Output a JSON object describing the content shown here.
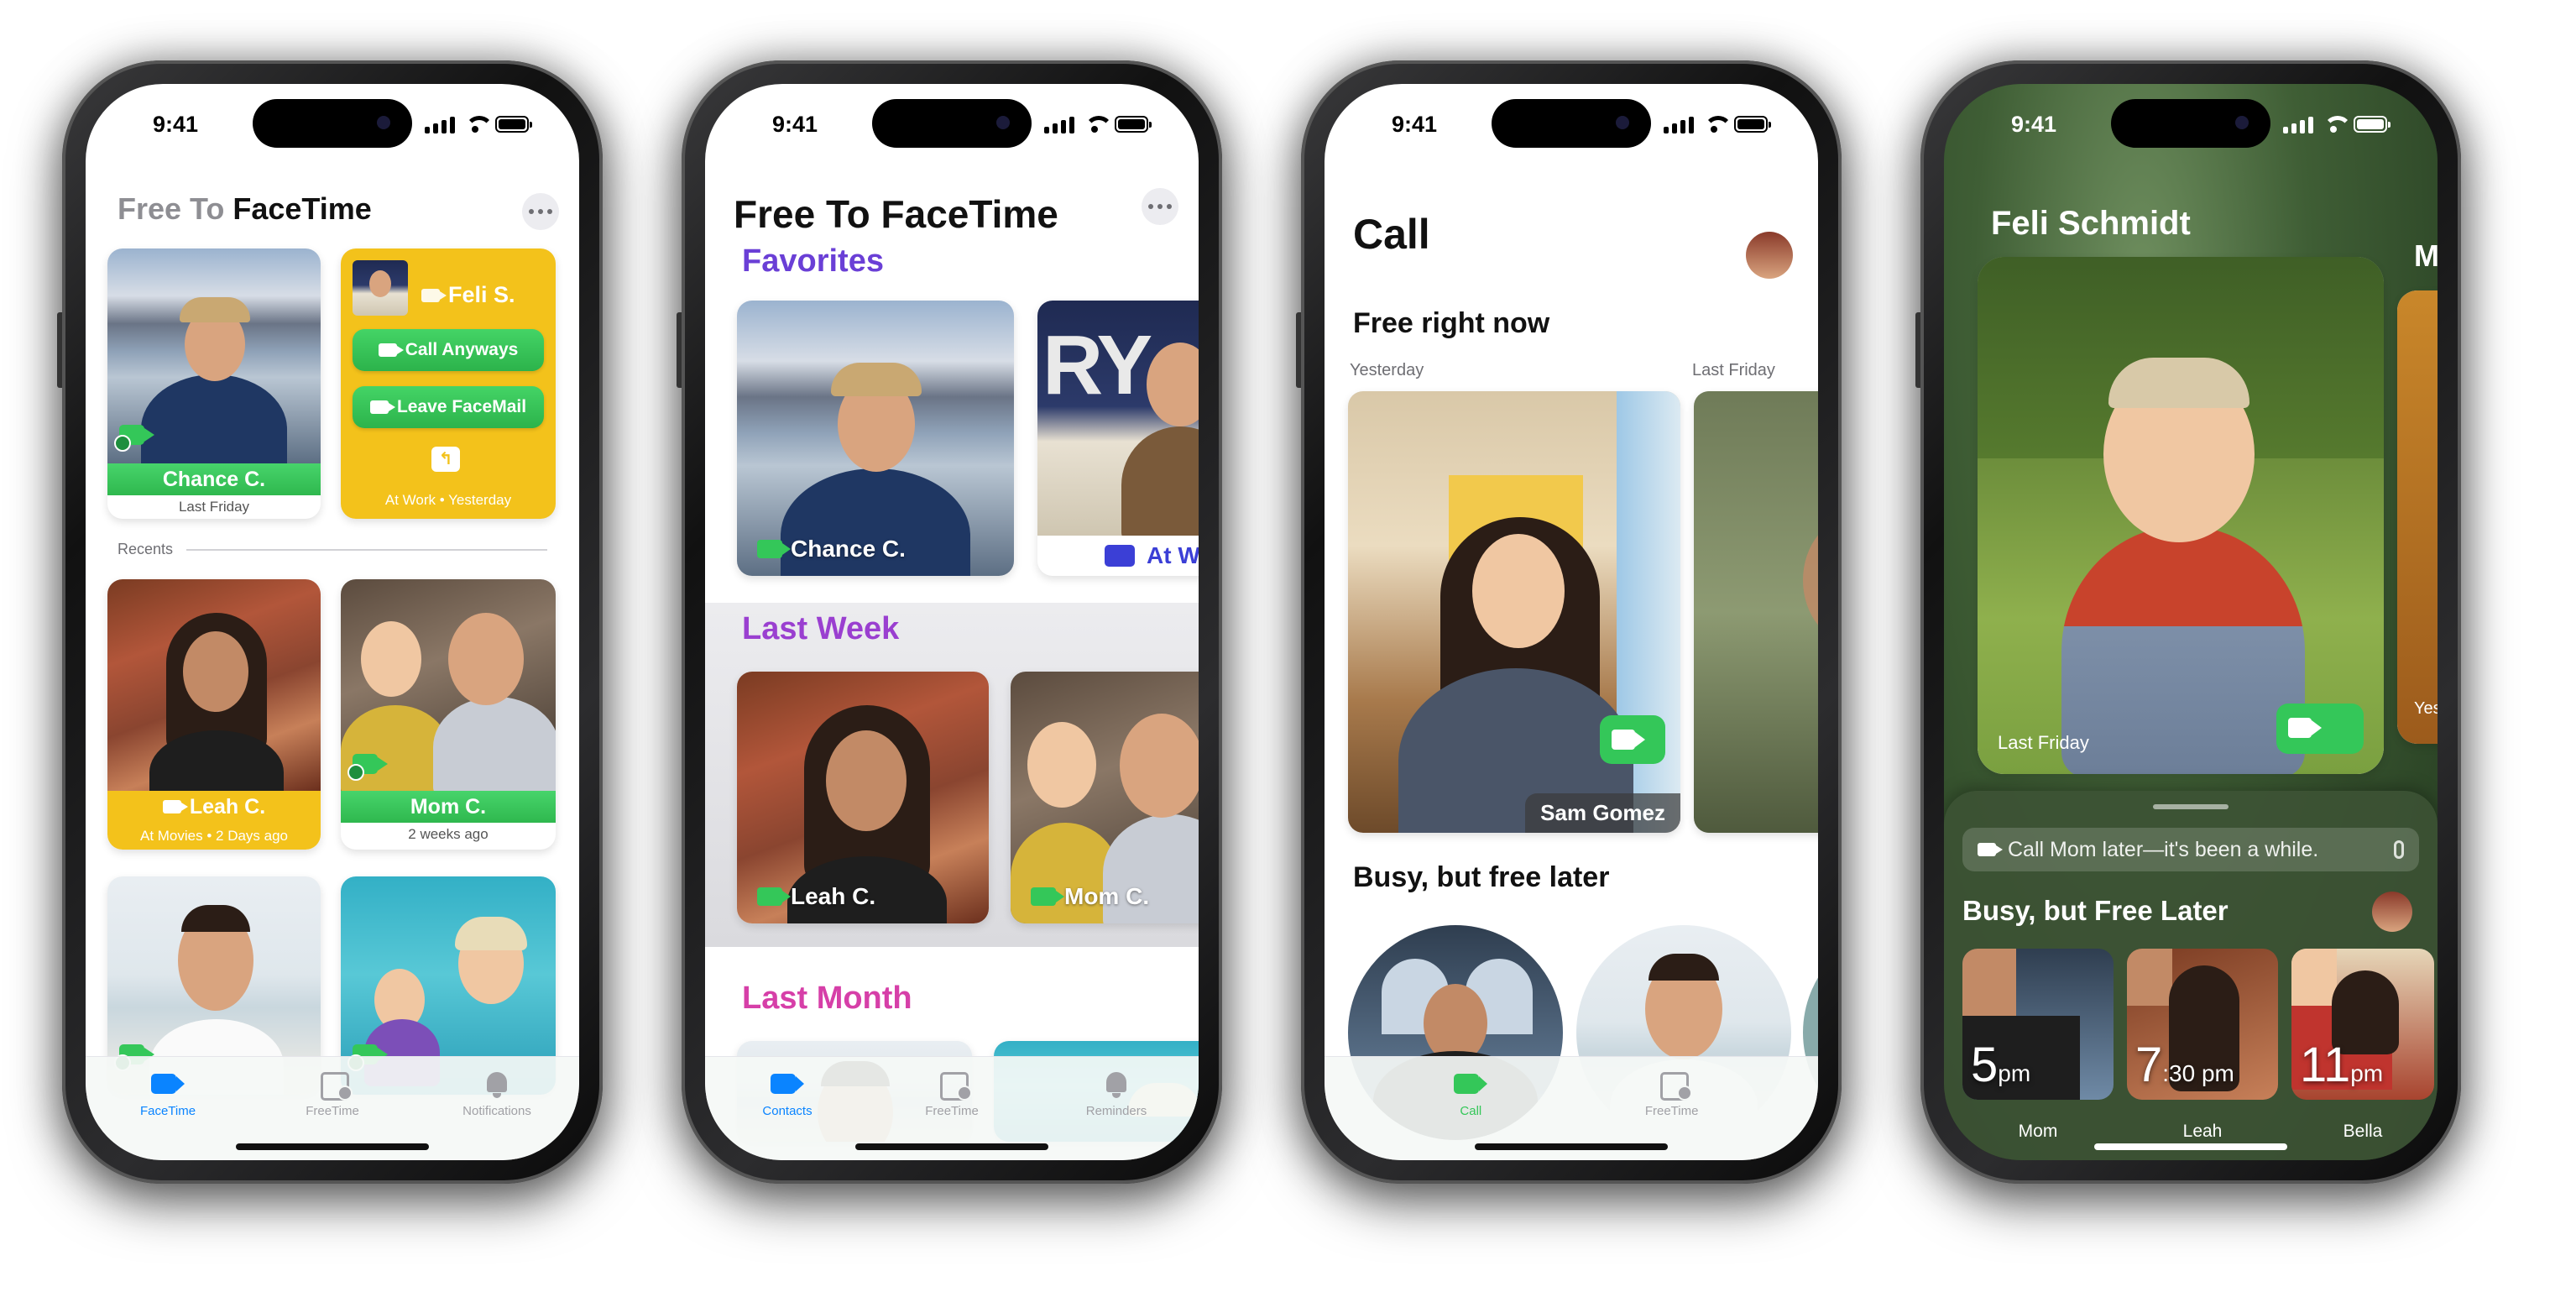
{
  "status_time": "9:41",
  "screen1": {
    "title_light": "Free To",
    "title_bold": "FaceTime",
    "fav1": {
      "name": "Chance C.",
      "caption": "Last Friday"
    },
    "fav2": {
      "name": "Feli S.",
      "call_anyways": "Call Anyways",
      "leave_facemail": "Leave FaceMail",
      "caption": "At Work • Yesterday"
    },
    "recents_label": "Recents",
    "recent1": {
      "name": "Leah C.",
      "caption": "At Movies • 2 Days ago"
    },
    "recent2": {
      "name": "Mom C.",
      "caption": "2 weeks ago"
    },
    "tabs": [
      "FaceTime",
      "FreeTime",
      "Notifications"
    ]
  },
  "screen2": {
    "title": "Free To FaceTime",
    "sections": {
      "favorites": "Favorites",
      "last_week": "Last Week",
      "last_month": "Last Month"
    },
    "fav1_name": "Chance C.",
    "fav2_status": "At W",
    "week1_name": "Leah C.",
    "week2_name": "Mom C.",
    "tabs": [
      "Contacts",
      "FreeTime",
      "Reminders"
    ]
  },
  "screen3": {
    "title": "Call",
    "free_now": "Free right now",
    "card1_when": "Yesterday",
    "card2_when": "Last Friday",
    "card1_name": "Sam Gomez",
    "busy_later": "Busy, but free later",
    "tabs": [
      "Call",
      "FreeTime"
    ]
  },
  "screen4": {
    "name": "Feli Schmidt",
    "next_peek": "Ma",
    "hero_caption": "Last Friday",
    "peek_caption": "Yeste",
    "siri_text": "Call Mom later—it's been a while.",
    "sheet_title": "Busy, but Free Later",
    "tiles": [
      {
        "hour": "5",
        "suffix": "pm",
        "name": "Mom"
      },
      {
        "hour": "7",
        "suffix": ":30 pm",
        "name": "Leah"
      },
      {
        "hour": "11",
        "suffix": "pm",
        "name": "Bella"
      }
    ]
  },
  "colors": {
    "facetime_green": "#34c759",
    "favorites_purple": "#6a3fd6",
    "last_week_purple": "#9a3fd0",
    "last_month_pink": "#d63fa8",
    "away_yellow": "#f3c21b"
  }
}
